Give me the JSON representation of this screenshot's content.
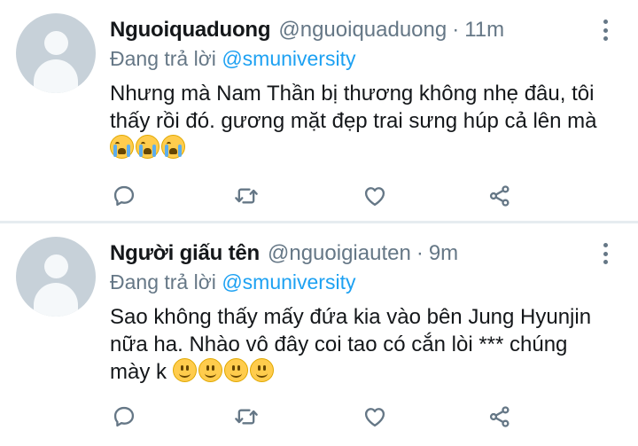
{
  "tweets": [
    {
      "display_name": "Nguoiquaduong",
      "handle": "@nguoiquaduong",
      "separator": "·",
      "time": "11m",
      "replying_prefix": "Đang trả lời",
      "replying_to": "@smuniversity",
      "text": "Nhưng mà Nam Thần bị thương không nhẹ đâu, tôi thấy rồi đó. gương mặt đẹp trai sưng húp cả lên mà",
      "emojis": [
        "crying-face",
        "crying-face",
        "crying-face"
      ]
    },
    {
      "display_name": "Người giấu tên",
      "handle": "@nguoigiauten",
      "separator": "·",
      "time": "9m",
      "replying_prefix": "Đang trả lời",
      "replying_to": "@smuniversity",
      "text": "Sao không thấy mấy đứa kia vào bên Jung Hyunjin nữa ha. Nhào vô đây coi tao có cắn lòi *** chúng mày k",
      "emojis": [
        "smiling-face",
        "smiling-face",
        "smiling-face",
        "smiling-face"
      ]
    }
  ],
  "icons": {
    "reply": "reply-icon",
    "retweet": "retweet-icon",
    "like": "like-icon",
    "share": "share-icon",
    "more": "more-vertical-icon"
  },
  "colors": {
    "name": "#14171a",
    "secondary": "#657786",
    "link": "#1da1f2",
    "divider": "#e6ecf0",
    "avatar": "#c7d1d9"
  }
}
